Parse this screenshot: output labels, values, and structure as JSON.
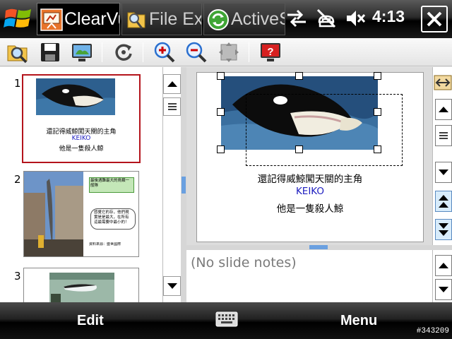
{
  "taskbar": {
    "tabs": [
      {
        "label": "ClearVu",
        "active": true
      },
      {
        "label": "File Exp",
        "active": false
      },
      {
        "label": "ActiveS",
        "active": false
      }
    ],
    "clock": "4:13"
  },
  "toolbar": {
    "buttons": [
      "open-icon",
      "save-icon",
      "slideshow-icon",
      "rotate-icon",
      "zoom-in-icon",
      "zoom-out-icon",
      "fit-icon",
      "help-icon"
    ]
  },
  "slides": [
    {
      "number": "1",
      "lines": [
        "還記得威鯨闖天關的主角",
        "KEIKO",
        "他是一隻殺人鯨"
      ]
    },
    {
      "number": "2",
      "box_top": "最後遇難最大的鳥類一般隊",
      "box_bubble": "感覺它的存，他們現實是是最大，在所有這最需要中最小的！",
      "footer": "資料來源：盛世國際"
    },
    {
      "number": "3"
    }
  ],
  "current_slide": {
    "line1": "還記得威鯨闖天關的主角",
    "line2": "KEIKO",
    "line3": "他是一隻殺人鯨"
  },
  "notes": {
    "text": "(No slide notes)"
  },
  "softkeys": {
    "left": "Edit",
    "right": "Menu"
  },
  "watermark": "#343209",
  "colors": {
    "selection_border": "#b4141c",
    "accent_blue": "#2020c0"
  }
}
